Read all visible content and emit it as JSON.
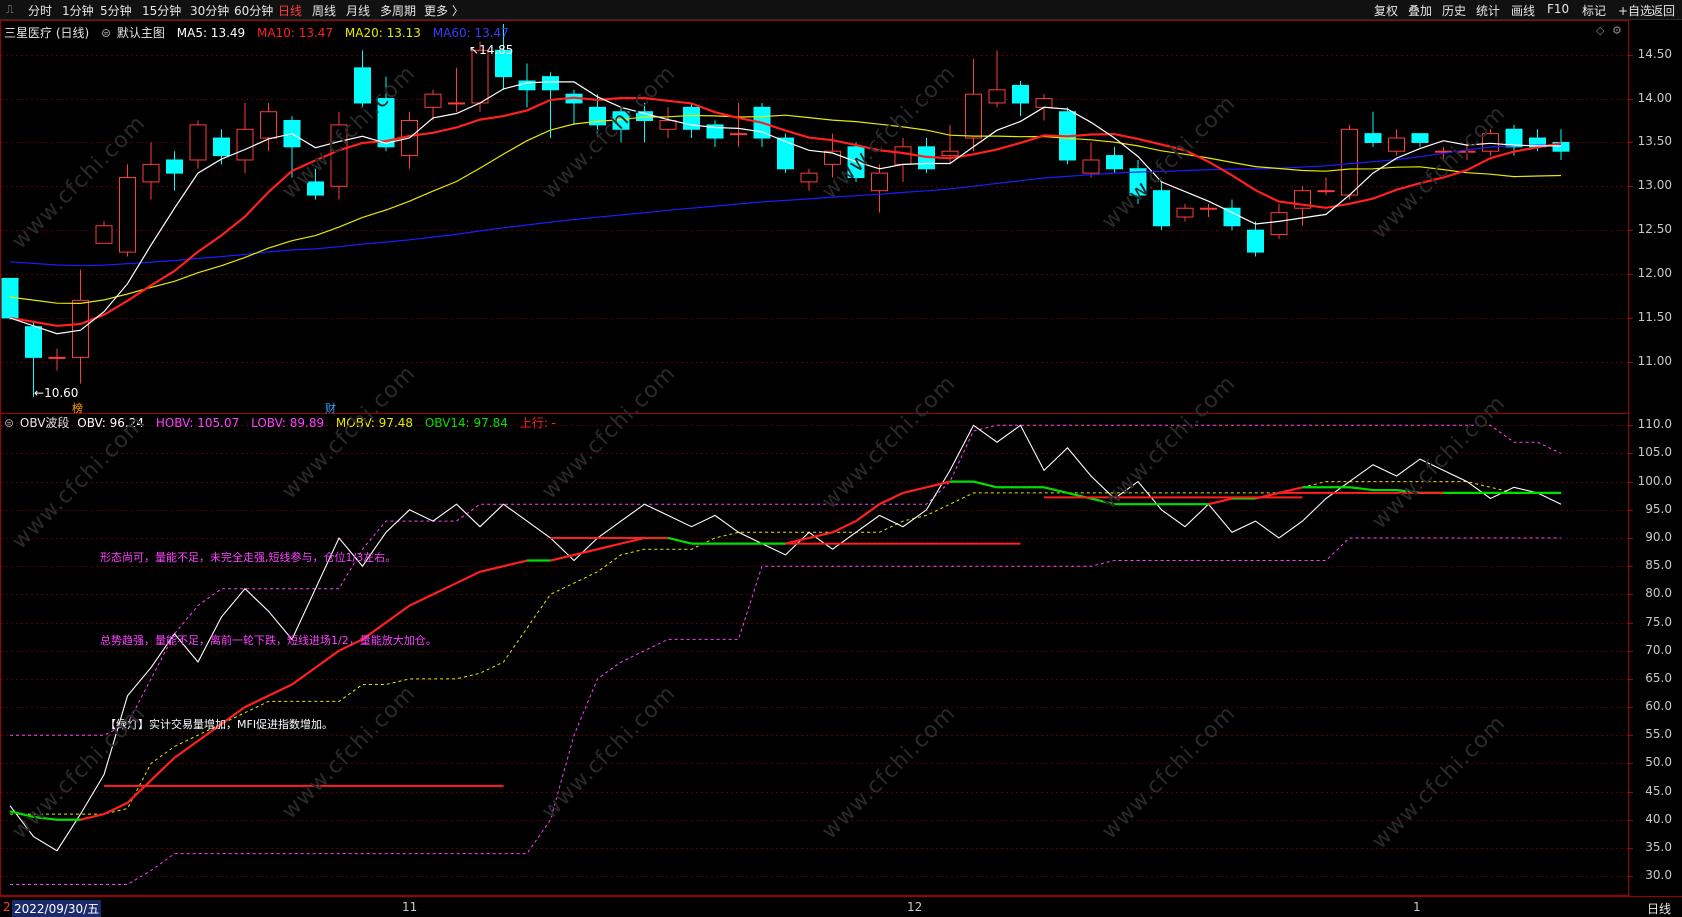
{
  "toolbar": {
    "left_items": [
      {
        "label": "分时",
        "active": false
      },
      {
        "label": "1分钟",
        "active": false
      },
      {
        "label": "5分钟",
        "active": false
      },
      {
        "label": "15分钟",
        "active": false
      },
      {
        "label": "30分钟",
        "active": false
      },
      {
        "label": "60分钟",
        "active": false
      },
      {
        "label": "日线",
        "active": true
      },
      {
        "label": "周线",
        "active": false
      },
      {
        "label": "月线",
        "active": false
      },
      {
        "label": "多周期",
        "active": false
      },
      {
        "label": "更多 〉",
        "active": false
      }
    ],
    "right_items": [
      "复权",
      "叠加",
      "历史",
      "统计",
      "画线",
      "F10",
      "标记",
      "+自选",
      "返回"
    ]
  },
  "main_legend": {
    "title": "三星医疗 (日线)",
    "preset": "默认主图",
    "ma5": "MA5: 13.49",
    "ma10": "MA10: 13.47",
    "ma20": "MA20: 13.13",
    "ma60": "MA60: 13.47"
  },
  "obv_legend": {
    "title": "OBV波段",
    "obv": "OBV: 96.24",
    "hobv": "HOBV: 105.07",
    "lobv": "LOBV: 89.89",
    "mobv": "MOBV: 97.48",
    "obv14": "OBV14: 97.84",
    "shangxing": "上行: -"
  },
  "annotations": {
    "high": "14.85",
    "low": "10.60",
    "marker_bang": "榜",
    "marker_cai": "财",
    "note1": "形态尚可，量能不足，未完全走强,短线参与，仓位1/3左右。",
    "note2": "总势趋强，量能不足，离前一轮下跌，短线进场1/2，量能放大加仓。",
    "note3": "【绿灯】实计交易量增加，MFI促进指数增加。"
  },
  "axes": {
    "price_ticks": [
      "14.50",
      "14.00",
      "13.50",
      "13.00",
      "12.50",
      "12.00",
      "11.50",
      "11.00"
    ],
    "obv_ticks": [
      "110.0",
      "105.0",
      "100.0",
      "95.0",
      "90.0",
      "85.0",
      "80.0",
      "75.0",
      "70.0",
      "65.0",
      "60.0",
      "55.0",
      "50.0",
      "45.0",
      "40.0",
      "35.0",
      "30.0"
    ],
    "date_first": "2022/09/30/五",
    "date_marks": [
      "11",
      "12",
      "1"
    ],
    "period_label": "日线",
    "first_mark": "2"
  },
  "watermark": "www.cfchi.com",
  "colors": {
    "up": "#ff3b3b",
    "down": "#00ffff",
    "ma5": "#ffffff",
    "ma10": "#ff2020",
    "ma20": "#e8e800",
    "ma60": "#1c1cff",
    "obv": "#ffffff",
    "hobv": "#ff40ff",
    "mobv": "#e8e800",
    "obv14_up": "#ff2020",
    "obv14_down": "#00e000",
    "note": "#ff40ff"
  },
  "chart_data": [
    {
      "type": "candlestick",
      "title": "三星医疗 (日线)",
      "y_range": [
        10.45,
        14.85
      ],
      "candles": [
        [
          11.95,
          11.5,
          11.95,
          11.48
        ],
        [
          11.4,
          11.05,
          11.45,
          10.6
        ],
        [
          11.05,
          11.05,
          11.15,
          10.9
        ],
        [
          11.05,
          11.7,
          12.05,
          10.75
        ],
        [
          12.35,
          12.55,
          12.6,
          12.35
        ],
        [
          12.25,
          13.1,
          13.25,
          12.2
        ],
        [
          13.05,
          13.25,
          13.5,
          12.85
        ],
        [
          13.3,
          13.15,
          13.4,
          12.95
        ],
        [
          13.3,
          13.7,
          13.75,
          13.2
        ],
        [
          13.55,
          13.35,
          13.65,
          13.25
        ],
        [
          13.3,
          13.65,
          13.95,
          13.15
        ],
        [
          13.55,
          13.85,
          13.95,
          13.4
        ],
        [
          13.75,
          13.45,
          13.8,
          13.1
        ],
        [
          13.05,
          12.9,
          13.2,
          12.85
        ],
        [
          13.0,
          13.7,
          13.85,
          12.85
        ],
        [
          14.35,
          13.95,
          14.55,
          13.9
        ],
        [
          14.0,
          13.45,
          14.25,
          13.4
        ],
        [
          13.35,
          13.75,
          13.85,
          13.2
        ],
        [
          13.9,
          14.05,
          14.1,
          13.75
        ],
        [
          13.95,
          13.95,
          14.35,
          13.85
        ],
        [
          13.95,
          14.55,
          14.65,
          13.85
        ],
        [
          14.55,
          14.25,
          14.85,
          14.1
        ],
        [
          14.2,
          14.1,
          14.4,
          13.9
        ],
        [
          14.25,
          14.1,
          14.3,
          13.55
        ],
        [
          14.05,
          13.95,
          14.1,
          13.7
        ],
        [
          13.9,
          13.7,
          14.05,
          13.55
        ],
        [
          13.85,
          13.65,
          13.9,
          13.5
        ],
        [
          13.85,
          13.75,
          13.95,
          13.5
        ],
        [
          13.65,
          13.75,
          13.9,
          13.55
        ],
        [
          13.9,
          13.65,
          13.95,
          13.55
        ],
        [
          13.7,
          13.55,
          13.75,
          13.45
        ],
        [
          13.6,
          13.6,
          13.95,
          13.45
        ],
        [
          13.9,
          13.55,
          13.95,
          13.45
        ],
        [
          13.55,
          13.2,
          13.6,
          13.15
        ],
        [
          13.05,
          13.15,
          13.2,
          12.95
        ],
        [
          13.25,
          13.4,
          13.6,
          13.1
        ],
        [
          13.45,
          13.1,
          13.5,
          13.05
        ],
        [
          12.95,
          13.15,
          13.25,
          12.7
        ],
        [
          13.25,
          13.45,
          13.55,
          13.05
        ],
        [
          13.45,
          13.2,
          13.55,
          13.15
        ],
        [
          13.35,
          13.4,
          13.7,
          13.25
        ],
        [
          13.55,
          14.05,
          14.45,
          13.4
        ],
        [
          13.95,
          14.1,
          14.55,
          13.9
        ],
        [
          14.15,
          13.95,
          14.2,
          13.8
        ],
        [
          13.9,
          14.0,
          14.05,
          13.75
        ],
        [
          13.85,
          13.3,
          13.9,
          13.25
        ],
        [
          13.15,
          13.3,
          13.5,
          13.1
        ],
        [
          13.35,
          13.2,
          13.45,
          13.15
        ],
        [
          13.2,
          12.9,
          13.3,
          12.8
        ],
        [
          12.95,
          12.55,
          13.05,
          12.5
        ],
        [
          12.65,
          12.75,
          12.8,
          12.6
        ],
        [
          12.75,
          12.75,
          12.8,
          12.65
        ],
        [
          12.75,
          12.55,
          12.85,
          12.5
        ],
        [
          12.5,
          12.25,
          12.6,
          12.2
        ],
        [
          12.45,
          12.7,
          12.8,
          12.4
        ],
        [
          12.75,
          12.95,
          13.0,
          12.55
        ],
        [
          12.95,
          12.95,
          13.1,
          12.9
        ],
        [
          12.9,
          13.65,
          13.7,
          12.85
        ],
        [
          13.6,
          13.5,
          13.85,
          13.45
        ],
        [
          13.4,
          13.55,
          13.65,
          13.35
        ],
        [
          13.6,
          13.5,
          13.6,
          13.45
        ],
        [
          13.4,
          13.4,
          13.45,
          13.3
        ],
        [
          13.4,
          13.4,
          13.5,
          13.3
        ],
        [
          13.4,
          13.6,
          13.65,
          13.35
        ],
        [
          13.65,
          13.45,
          13.7,
          13.35
        ],
        [
          13.55,
          13.45,
          13.65,
          13.4
        ],
        [
          13.5,
          13.4,
          13.65,
          13.3
        ]
      ]
    },
    {
      "type": "line",
      "title": "OBV波段",
      "y_range": [
        27,
        112
      ],
      "series": [
        {
          "name": "OBV",
          "values": [
            42.5,
            37,
            34.5,
            41,
            48,
            62,
            67,
            73,
            68,
            76,
            81,
            77,
            72,
            81,
            90,
            85,
            91,
            95,
            93,
            96,
            92,
            96,
            93,
            90,
            86,
            90,
            93,
            96,
            94,
            92,
            94,
            91,
            89,
            87,
            91,
            88,
            91,
            94,
            92,
            95,
            102,
            110,
            107,
            110,
            102,
            106,
            101,
            97,
            100,
            95,
            92,
            96,
            91,
            93,
            90,
            93,
            97,
            100,
            103,
            101,
            104,
            102,
            100,
            97,
            99,
            98,
            96
          ]
        },
        {
          "name": "HOBV",
          "values": [
            55,
            55,
            55,
            55,
            55,
            57,
            65,
            73,
            78,
            81,
            81,
            81,
            81,
            81,
            81,
            88,
            93,
            93,
            93,
            93,
            96,
            96,
            96,
            96,
            96,
            96,
            96,
            96,
            96,
            96,
            96,
            96,
            96,
            96,
            96,
            96,
            96,
            96,
            96,
            96,
            100,
            109,
            110,
            110,
            110,
            110,
            110,
            110,
            110,
            110,
            110,
            110,
            110,
            110,
            110,
            110,
            110,
            110,
            110,
            110,
            110,
            110,
            110,
            110,
            107,
            107,
            105
          ]
        },
        {
          "name": "LOBV",
          "values": [
            28.5,
            28.5,
            28.5,
            28.5,
            28.5,
            28.5,
            31,
            34,
            34,
            34,
            34,
            34,
            34,
            34,
            34,
            34,
            34,
            34,
            34,
            34,
            34,
            34,
            34,
            40,
            55,
            65,
            68,
            70,
            72,
            72,
            72,
            72,
            85,
            85,
            85,
            85,
            85,
            85,
            85,
            85,
            85,
            85,
            85,
            85,
            85,
            85,
            85,
            86,
            86,
            86,
            86,
            86,
            86,
            86,
            86,
            86,
            86,
            90,
            90,
            90,
            90,
            90,
            90,
            90,
            90,
            90,
            90
          ]
        },
        {
          "name": "MOBV",
          "values": [
            41,
            41,
            41,
            41,
            41,
            42,
            50,
            53,
            55,
            57,
            59,
            61,
            61,
            61,
            61,
            64,
            64,
            65,
            65,
            65,
            66,
            68,
            74,
            80,
            82,
            84,
            87,
            88,
            88,
            88,
            90,
            91,
            91,
            91,
            91,
            91,
            91,
            91,
            93,
            94,
            96,
            98,
            98,
            98,
            98,
            98,
            98,
            98,
            98,
            98,
            98,
            98,
            98,
            98,
            98,
            99,
            100,
            100,
            100,
            100,
            100,
            100,
            100,
            99,
            98,
            98,
            98
          ]
        },
        {
          "name": "OBV14",
          "values": [
            41.5,
            40.5,
            40,
            40,
            41,
            43,
            47,
            51,
            54,
            57,
            60,
            62,
            64,
            67,
            70,
            72,
            75,
            78,
            80,
            82,
            84,
            85,
            86,
            86,
            87,
            88,
            89,
            90,
            90,
            89,
            89,
            89,
            89,
            89,
            90,
            91,
            93,
            96,
            98,
            99,
            100,
            100,
            99,
            99,
            99,
            98,
            97,
            96,
            96,
            96,
            96,
            96,
            97,
            97,
            98,
            99,
            99,
            99,
            98.5,
            98.5,
            98,
            98,
            98,
            98,
            98,
            98,
            98
          ]
        }
      ]
    }
  ]
}
